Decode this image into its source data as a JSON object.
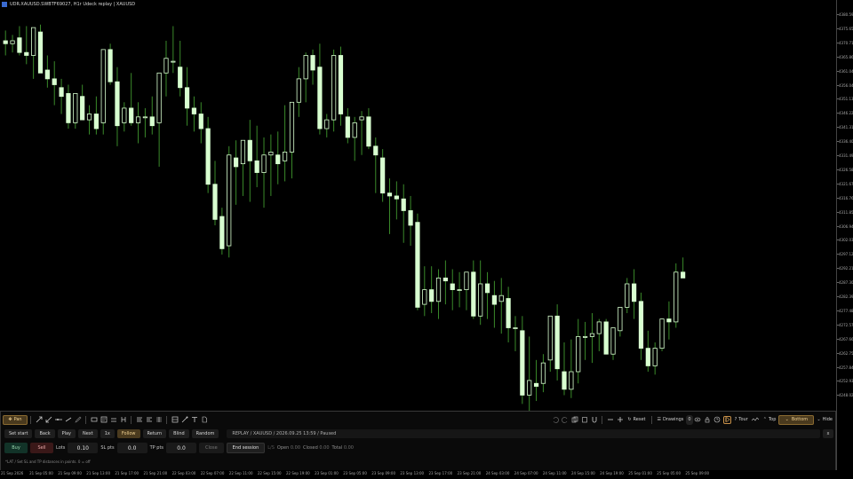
{
  "window": {
    "title": "UDR.XAUUSD.SWBTF69027, H1r Udeck replay | XAUUSD"
  },
  "colors": {
    "background": "#000000",
    "candle_up": "#d8ffd0",
    "candle_down": "#d8ffd0",
    "wick": "#3a8a2a",
    "accent": "#c89048"
  },
  "price_axis": {
    "ticks": [
      "4380.59",
      "4375.65",
      "4370.71",
      "4365.86",
      "4361.04",
      "4356.04",
      "4351.13",
      "4346.22",
      "4341.31",
      "4336.40",
      "4331.49",
      "4326.58",
      "4321.67",
      "4316.76",
      "4311.85",
      "4306.94",
      "4302.03",
      "4297.12",
      "4292.21",
      "4287.30",
      "4282.39",
      "4277.48",
      "4272.57",
      "4267.66",
      "4262.75",
      "4257.84",
      "4252.93",
      "4248.02"
    ]
  },
  "time_axis": {
    "ticks": [
      "21 Sep 2026",
      "21 Sep 05:00",
      "21 Sep 09:00",
      "21 Sep 13:00",
      "21 Sep 17:00",
      "21 Sep 21:00",
      "22 Sep 03:00",
      "22 Sep 07:00",
      "22 Sep 11:00",
      "22 Sep 15:00",
      "22 Sep 19:00",
      "23 Sep 01:00",
      "23 Sep 05:00",
      "23 Sep 09:00",
      "23 Sep 13:00",
      "23 Sep 17:00",
      "23 Sep 21:00",
      "24 Sep 03:00",
      "24 Sep 07:00",
      "24 Sep 11:00",
      "24 Sep 15:00",
      "24 Sep 19:00",
      "25 Sep 01:00",
      "25 Sep 05:00",
      "25 Sep 09:00"
    ]
  },
  "chart_data": {
    "type": "candlestick",
    "symbol": "XAUUSD",
    "timeframe": "H1",
    "ylim": [
      4246.5,
      4382.5
    ],
    "candles": [
      [
        4371,
        4374.5,
        4366,
        4370
      ],
      [
        4370,
        4373,
        4367,
        4371
      ],
      [
        4372,
        4376,
        4366,
        4367
      ],
      [
        4367,
        4376,
        4363,
        4366
      ],
      [
        4366,
        4375.5,
        4358,
        4375.5
      ],
      [
        4374,
        4376.5,
        4360,
        4360
      ],
      [
        4361,
        4366,
        4355,
        4358
      ],
      [
        4358,
        4364,
        4349,
        4356
      ],
      [
        4355,
        4358,
        4346,
        4352
      ],
      [
        4353,
        4356,
        4341,
        4343
      ],
      [
        4343,
        4353,
        4341,
        4353
      ],
      [
        4352,
        4356,
        4344,
        4344
      ],
      [
        4344,
        4349,
        4339,
        4346
      ],
      [
        4346,
        4352,
        4339,
        4341
      ],
      [
        4343,
        4368,
        4339,
        4368
      ],
      [
        4368,
        4370,
        4356,
        4357
      ],
      [
        4357,
        4362,
        4335,
        4342
      ],
      [
        4343,
        4350,
        4340,
        4348
      ],
      [
        4348,
        4360,
        4342,
        4343
      ],
      [
        4343,
        4350,
        4336,
        4345
      ],
      [
        4345,
        4348,
        4338,
        4345
      ],
      [
        4345,
        4352,
        4339,
        4342
      ],
      [
        4343,
        4360,
        4328,
        4360
      ],
      [
        4360,
        4371,
        4352,
        4365
      ],
      [
        4364,
        4376,
        4360,
        4364
      ],
      [
        4362,
        4371,
        4352,
        4355
      ],
      [
        4355,
        4362,
        4342,
        4348
      ],
      [
        4348,
        4352,
        4340,
        4346
      ],
      [
        4346,
        4350,
        4336,
        4341
      ],
      [
        4341,
        4345,
        4319,
        4322
      ],
      [
        4322,
        4330,
        4308,
        4310
      ],
      [
        4311,
        4314,
        4298,
        4300
      ],
      [
        4301,
        4335,
        4297,
        4332
      ],
      [
        4331,
        4337,
        4315,
        4328
      ],
      [
        4329,
        4337,
        4318,
        4337
      ],
      [
        4337,
        4344,
        4316,
        4330
      ],
      [
        4330,
        4342,
        4321,
        4326
      ],
      [
        4326,
        4338,
        4314,
        4332
      ],
      [
        4332,
        4339,
        4318,
        4333
      ],
      [
        4332,
        4340,
        4322,
        4329
      ],
      [
        4330,
        4349,
        4323,
        4333
      ],
      [
        4333,
        4350,
        4324,
        4350
      ],
      [
        4350,
        4362,
        4345,
        4358
      ],
      [
        4358,
        4367,
        4350,
        4366
      ],
      [
        4366,
        4368,
        4356,
        4361
      ],
      [
        4362,
        4370,
        4339,
        4341
      ],
      [
        4341,
        4346,
        4338,
        4344
      ],
      [
        4344,
        4368,
        4340,
        4366
      ],
      [
        4366,
        4369,
        4342,
        4346
      ],
      [
        4345,
        4348,
        4336,
        4338
      ],
      [
        4338,
        4345,
        4330,
        4343
      ],
      [
        4344,
        4347,
        4332,
        4345
      ],
      [
        4345,
        4348,
        4334,
        4335
      ],
      [
        4335,
        4338,
        4319,
        4332
      ],
      [
        4331,
        4334,
        4316,
        4319
      ],
      [
        4319,
        4324,
        4305,
        4318
      ],
      [
        4318,
        4323,
        4310,
        4317
      ],
      [
        4317,
        4322,
        4302,
        4313
      ],
      [
        4313,
        4318,
        4301,
        4308
      ],
      [
        4309,
        4312,
        4279,
        4280
      ],
      [
        4281,
        4294,
        4277,
        4286
      ],
      [
        4286,
        4294,
        4278,
        4282
      ],
      [
        4282,
        4293,
        4276,
        4290
      ],
      [
        4290,
        4296,
        4281,
        4289
      ],
      [
        4288,
        4293,
        4279,
        4286
      ],
      [
        4286,
        4292,
        4280,
        4286
      ],
      [
        4286,
        4291,
        4279,
        4292
      ],
      [
        4292,
        4296,
        4276,
        4277
      ],
      [
        4277,
        4296,
        4274,
        4288
      ],
      [
        4288,
        4292,
        4276,
        4285
      ],
      [
        4284,
        4289,
        4273,
        4281
      ],
      [
        4282,
        4290,
        4271,
        4284
      ],
      [
        4283,
        4287,
        4268,
        4273
      ],
      [
        4273,
        4277,
        4265,
        4273
      ],
      [
        4272,
        4277,
        4247,
        4250
      ],
      [
        4250,
        4270,
        4244,
        4255
      ],
      [
        4254,
        4262,
        4248,
        4253
      ],
      [
        4254,
        4264,
        4251,
        4261
      ],
      [
        4262,
        4277,
        4258,
        4277
      ],
      [
        4277,
        4281,
        4255,
        4259
      ],
      [
        4258,
        4268,
        4250,
        4252
      ],
      [
        4252,
        4269,
        4249,
        4258
      ],
      [
        4258,
        4276,
        4254,
        4270
      ],
      [
        4270,
        4275,
        4262,
        4270
      ],
      [
        4270,
        4278,
        4261,
        4271
      ],
      [
        4271,
        4276,
        4265,
        4275
      ],
      [
        4275,
        4276,
        4266,
        4264
      ],
      [
        4264,
        4273,
        4262,
        4273
      ],
      [
        4272,
        4280,
        4270,
        4280
      ],
      [
        4280,
        4290,
        4278,
        4288
      ],
      [
        4288,
        4293,
        4276,
        4282
      ],
      [
        4282,
        4285,
        4262,
        4266
      ],
      [
        4266,
        4272,
        4258,
        4260
      ],
      [
        4260,
        4268,
        4257,
        4266
      ],
      [
        4266,
        4276,
        4265,
        4276
      ],
      [
        4276,
        4282,
        4269,
        4275
      ],
      [
        4275,
        4295,
        4273,
        4292
      ],
      [
        4292,
        4297,
        4291,
        4290
      ]
    ]
  },
  "toolbar": {
    "pan_label": "Pan",
    "reset_label": "Reset",
    "drawings_label": "Drawings",
    "drawings_count": "0",
    "tour_label": "Tour",
    "top_label": "Top",
    "bottom_label": "Bottom",
    "hide_label": "Hide"
  },
  "replay": {
    "set_start": "Set start",
    "back": "Back",
    "play": "Play",
    "next": "Next",
    "speed": "1x",
    "follow": "Follow",
    "return": "Return",
    "blind": "Blind",
    "random": "Random",
    "status": "REPLAY  /  XAUUSD  /  2026.09.25 13:59  /  Paused",
    "close_x": "x"
  },
  "trade": {
    "buy": "Buy",
    "sell": "Sell",
    "lots_label": "Lots",
    "lots_value": "0.10",
    "sl_label": "SL pts",
    "sl_value": "0.0",
    "tp_label": "TP pts",
    "tp_value": "0.0",
    "close": "Close",
    "end_session": "End session",
    "ls_label": "L/S",
    "open_label": "Open",
    "open_value": "0.00",
    "closed_label": "Closed",
    "closed_value": "0.00",
    "total_label": "Total",
    "total_value": "0.00"
  },
  "hint": "*LAT  /  Set SL and TP distances in points. 0 = off"
}
